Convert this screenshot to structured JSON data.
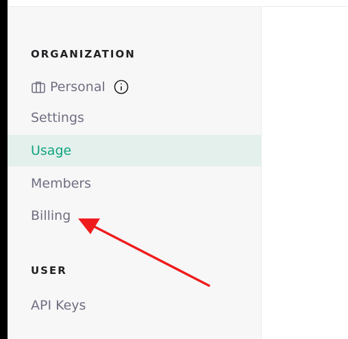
{
  "sidebar": {
    "organization_heading": "ORGANIZATION",
    "org_switcher": {
      "label": "Personal",
      "icon": "briefcase-icon",
      "info_icon": "info-icon"
    },
    "org_items": [
      {
        "label": "Settings",
        "active": false
      },
      {
        "label": "Usage",
        "active": true
      },
      {
        "label": "Members",
        "active": false
      },
      {
        "label": "Billing",
        "active": false
      }
    ],
    "user_heading": "USER",
    "user_items": [
      {
        "label": "API Keys",
        "active": false
      }
    ]
  },
  "annotation": {
    "type": "arrow",
    "color": "#ee1c1c",
    "points_to": "Billing"
  },
  "colors": {
    "accent": "#10a37f",
    "active_background": "#e3f0ec",
    "sidebar_background": "#f7f7f8",
    "muted_text": "#6e6e80",
    "heading_text": "#202123"
  }
}
